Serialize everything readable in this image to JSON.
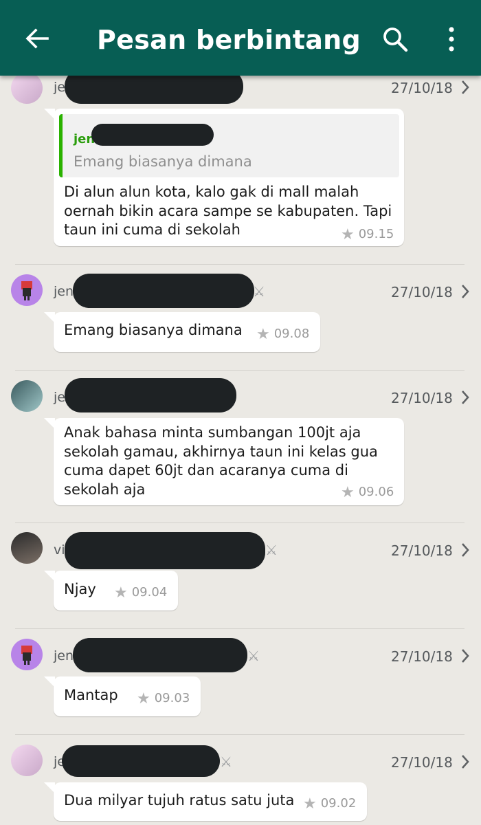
{
  "appbar": {
    "title": "Pesan berbintang",
    "icons": [
      "arrow-back-icon",
      "search-icon",
      "more-vert-icon"
    ]
  },
  "colors": {
    "appbar": "#075e54",
    "background": "#ebe9e4",
    "quote_bar": "#2ab200",
    "quote_sender": "#2a9d0c"
  },
  "messages": [
    {
      "sender_visible": "je",
      "date": "27/10/18",
      "quote": {
        "sender_visible": "jen",
        "text": "Emang biasanya dimana"
      },
      "lines": [
        "Di alun alun kota, kalo gak di mall malah",
        "oernah bikin acara sampe se kabupaten. Tapi",
        "taun ini cuma di sekolah"
      ],
      "time": "09.15"
    },
    {
      "sender_visible": "jen",
      "date": "27/10/18",
      "lines": [
        "Emang biasanya dimana"
      ],
      "time": "09.08"
    },
    {
      "sender_visible": "je",
      "date": "27/10/18",
      "lines": [
        "Anak bahasa minta sumbangan 100jt aja",
        "sekolah gamau, akhirnya taun ini kelas gua",
        "cuma dapet 60jt dan acaranya cuma di",
        "sekolah aja"
      ],
      "time": "09.06"
    },
    {
      "sender_visible": "vi",
      "date": "27/10/18",
      "lines": [
        "Njay"
      ],
      "time": "09.04"
    },
    {
      "sender_visible": "jen",
      "date": "27/10/18",
      "lines": [
        "Mantap"
      ],
      "time": "09.03"
    },
    {
      "sender_visible": "je",
      "date": "27/10/18",
      "lines": [
        "Dua milyar tujuh ratus satu juta"
      ],
      "time": "09.02"
    }
  ]
}
